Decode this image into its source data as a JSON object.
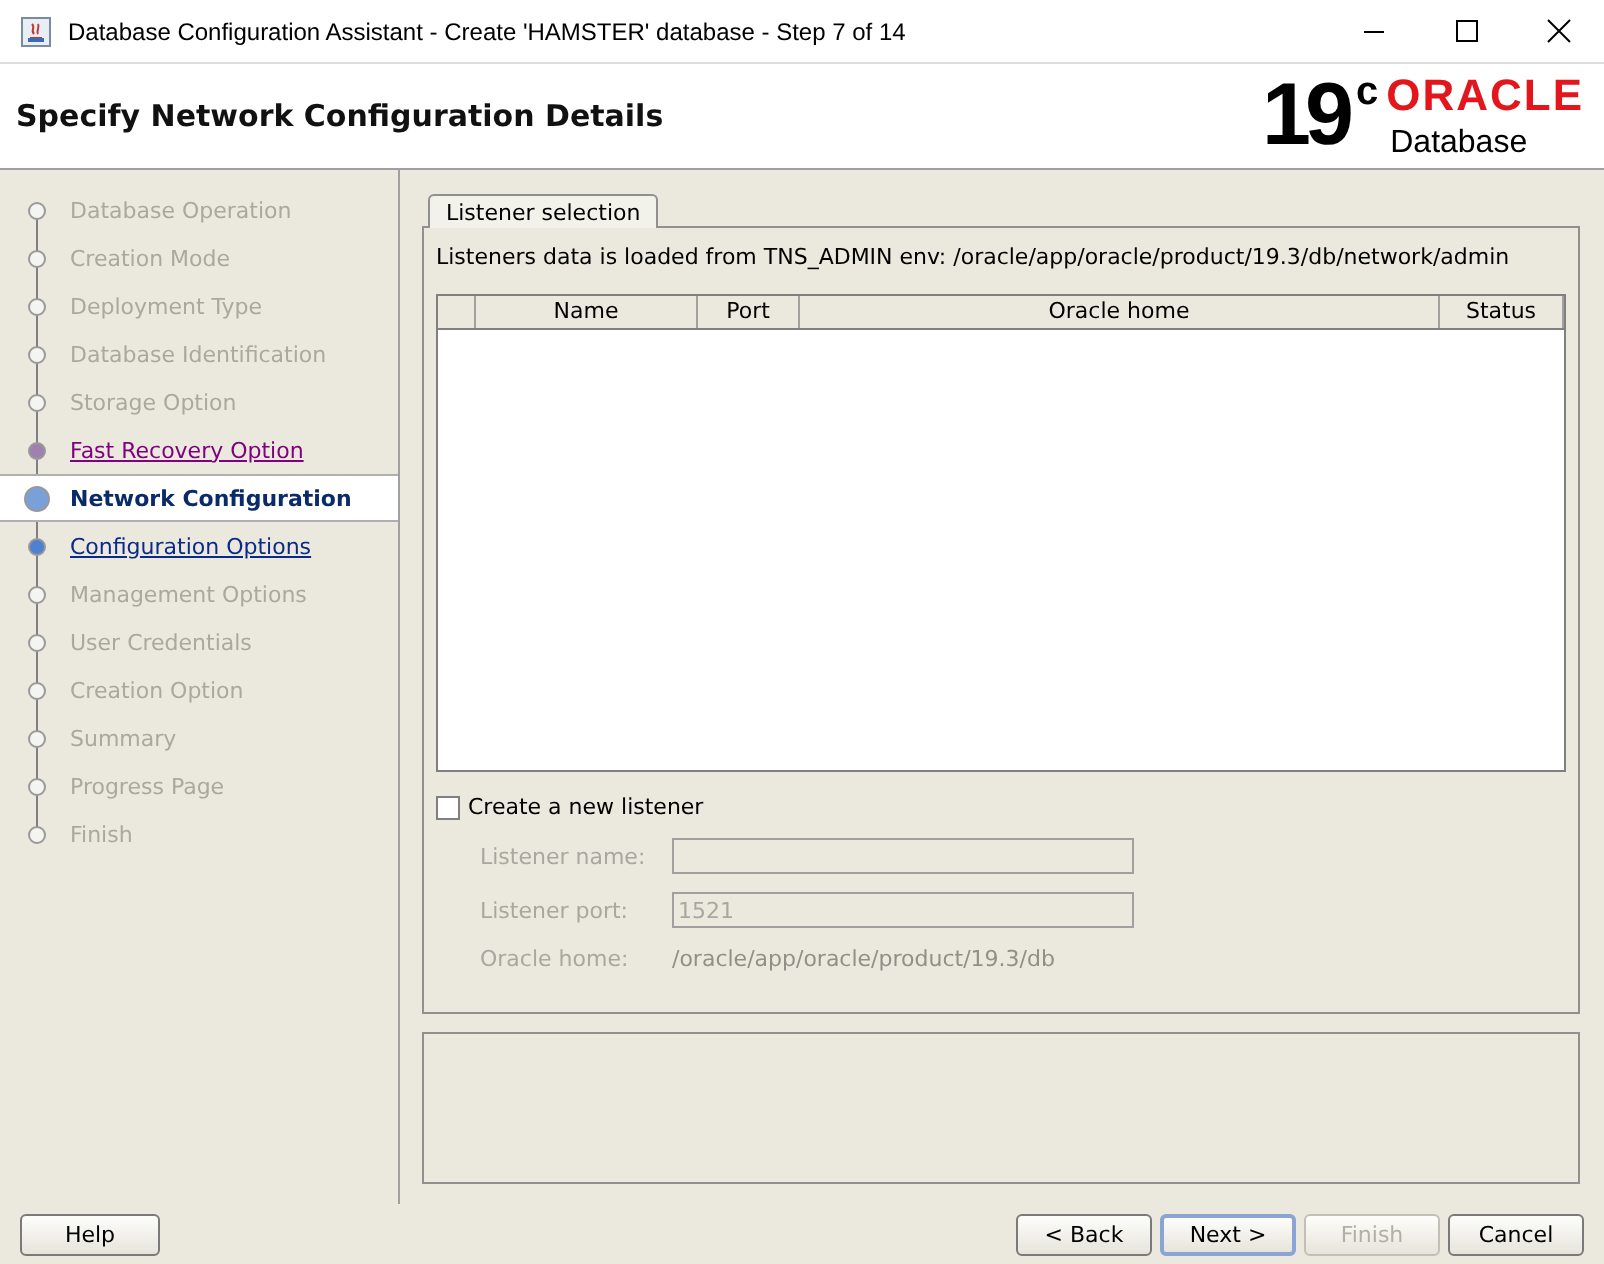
{
  "window": {
    "title": "Database Configuration Assistant - Create 'HAMSTER' database - Step 7 of 14"
  },
  "header": {
    "title": "Specify Network Configuration Details",
    "logo": {
      "version": "19",
      "superscript": "c",
      "brand": "ORACLE",
      "product": "Database"
    }
  },
  "steps": [
    {
      "label": "Database Operation",
      "selected": false,
      "enabled": false
    },
    {
      "label": "Creation Mode",
      "selected": false,
      "enabled": false
    },
    {
      "label": "Deployment Type",
      "selected": false,
      "enabled": false
    },
    {
      "label": "Database Identification",
      "selected": false,
      "enabled": false
    },
    {
      "label": "Storage Option",
      "selected": false,
      "enabled": false
    },
    {
      "label": "Fast Recovery Option",
      "selected": false,
      "enabled": true,
      "visited": true
    },
    {
      "label": "Network Configuration",
      "selected": true
    },
    {
      "label": "Configuration Options",
      "selected": false,
      "enabled": true,
      "visited": false
    },
    {
      "label": "Management Options",
      "selected": false,
      "enabled": false
    },
    {
      "label": "User Credentials",
      "selected": false,
      "enabled": false
    },
    {
      "label": "Creation Option",
      "selected": false,
      "enabled": false
    },
    {
      "label": "Summary",
      "selected": false,
      "enabled": false
    },
    {
      "label": "Progress Page",
      "selected": false,
      "enabled": false
    },
    {
      "label": "Finish",
      "selected": false,
      "enabled": false
    }
  ],
  "tabs": [
    {
      "label": "Listener selection",
      "selected": true
    }
  ],
  "info": "Listeners data is loaded from TNS_ADMIN env: /oracle/app/oracle/product/19.3/db/network/admin",
  "table": {
    "columns": [
      "Name",
      "Port",
      "Oracle home",
      "Status"
    ]
  },
  "new_listener": {
    "label": "Create a new listener",
    "checked": false,
    "fields": [
      {
        "kind": "input",
        "label": "Listener name:",
        "disabled": true
      },
      {
        "kind": "input",
        "label": "Listener port:",
        "value": "1521",
        "disabled": true
      },
      {
        "kind": "text",
        "label": "Oracle home:",
        "value": "/oracle/app/oracle/product/19.3/db",
        "disabled": true
      }
    ]
  },
  "help_button": {
    "label": "Help"
  },
  "buttons": [
    {
      "label": "< Back",
      "disabled": false,
      "default": false
    },
    {
      "label": "Next >",
      "disabled": false,
      "default": true
    },
    {
      "label": "Finish",
      "disabled": true,
      "default": false
    },
    {
      "label": "Cancel",
      "disabled": false,
      "default": false
    }
  ]
}
